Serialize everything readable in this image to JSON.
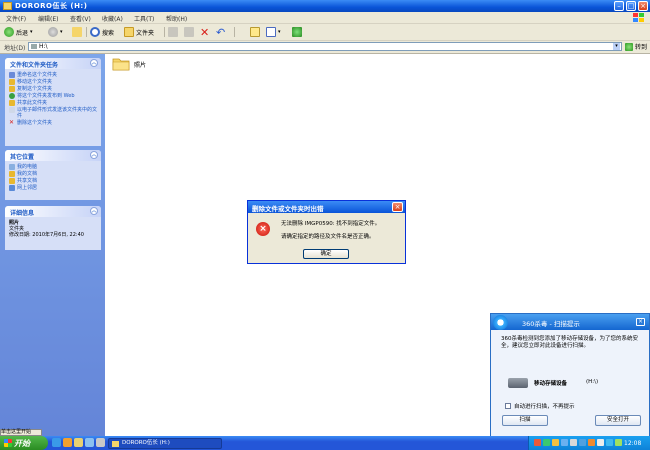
{
  "window": {
    "title": "DORORO伍长 (H:)"
  },
  "menu": [
    "文件(F)",
    "编辑(E)",
    "查看(V)",
    "收藏(A)",
    "工具(T)",
    "帮助(H)"
  ],
  "toolbar": {
    "back": "后退",
    "search": "搜索",
    "folders": "文件夹"
  },
  "address": {
    "label": "地址(D)",
    "value": "H:\\",
    "go": "转到"
  },
  "tasks_panel": {
    "title": "文件和文件夹任务",
    "items": [
      "重命名这个文件夹",
      "移动这个文件夹",
      "复制这个文件夹",
      "将这个文件夹发布到 Web",
      "共享此文件夹",
      "以电子邮件形式发送该文件夹中的文件",
      "删除这个文件夹"
    ]
  },
  "places_panel": {
    "title": "其它位置",
    "items": [
      "我的电脑",
      "我的文档",
      "共享文档",
      "网上邻居"
    ]
  },
  "details_panel": {
    "title": "详细信息",
    "name": "照片",
    "type": "文件夹",
    "modified": "修改日期: 2010年7月6日, 22:40"
  },
  "folder": {
    "name": "照片"
  },
  "error_dialog": {
    "title": "删除文件或文件夹时出错",
    "message1": "无法删除 IMGP0590: 找不到指定文件。",
    "message2": "请确定指定的路径及文件名是否正确。",
    "ok": "确定"
  },
  "popup": {
    "title": "360杀毒 - 扫描提示",
    "message": "360杀毒检测到您添加了移动存储设备，为了您的系统安全，建议您立即对此设备进行扫描。",
    "device_name": "移动存储设备",
    "device_drive": "(H:\\)",
    "checkbox_label": "自动进行扫描，不再提示",
    "scan_button": "扫描",
    "open_button": "安全打开"
  },
  "status_strip": {
    "text": "单击这里开始"
  },
  "taskbar": {
    "start": "开始",
    "task": "DORORO伍长 (H:)",
    "clock": "12:08"
  },
  "colors": {
    "xp_blue": "#0a54d8",
    "link_blue": "#215dc6",
    "start_green": "#2a8c22",
    "error_red": "#c8140a"
  }
}
